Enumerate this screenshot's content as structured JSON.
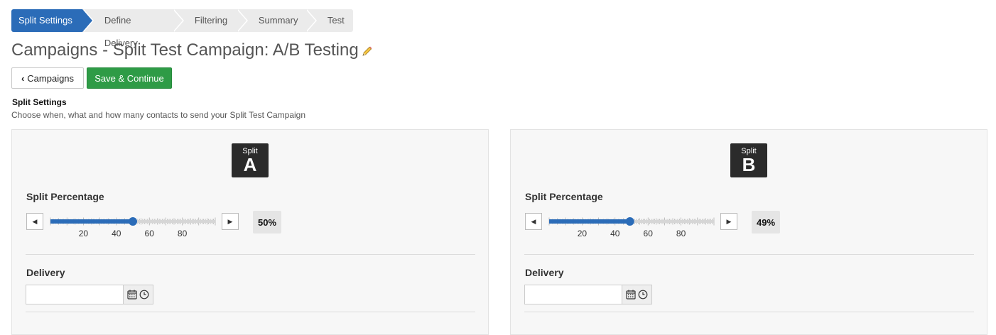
{
  "wizard": {
    "steps": [
      {
        "label": "Split Settings",
        "active": true
      },
      {
        "label": "Define Delivery",
        "active": false
      },
      {
        "label": "Filtering",
        "active": false
      },
      {
        "label": "Summary",
        "active": false
      },
      {
        "label": "Test",
        "active": false
      }
    ]
  },
  "page": {
    "title": "Campaigns - Split Test Campaign: A/B Testing",
    "edit_icon": "pencil-icon"
  },
  "toolbar": {
    "back_label": "Campaigns",
    "back_icon": "chevron-left-icon",
    "save_label": "Save & Continue"
  },
  "section": {
    "title": "Split Settings",
    "description": "Choose when, what and how many contacts to send your Split Test Campaign"
  },
  "splits": [
    {
      "badge_small": "Split",
      "badge_letter": "A",
      "percentage_label": "Split Percentage",
      "percentage": 50,
      "percentage_text": "50%",
      "delivery_label": "Delivery",
      "delivery_value": "",
      "tick_labels": [
        "20",
        "40",
        "60",
        "80"
      ]
    },
    {
      "badge_small": "Split",
      "badge_letter": "B",
      "percentage_label": "Split Percentage",
      "percentage": 49,
      "percentage_text": "49%",
      "delivery_label": "Delivery",
      "delivery_value": "",
      "tick_labels": [
        "20",
        "40",
        "60",
        "80"
      ]
    }
  ],
  "colors": {
    "accent": "#2b6cb8",
    "save": "#2e9b46",
    "badge": "#2b2b2b",
    "panel_bg": "#f7f7f7"
  },
  "icons": {
    "calendar": "calendar-icon",
    "clock": "clock-icon",
    "slider_left": "caret-left-icon",
    "slider_right": "caret-right-icon"
  }
}
